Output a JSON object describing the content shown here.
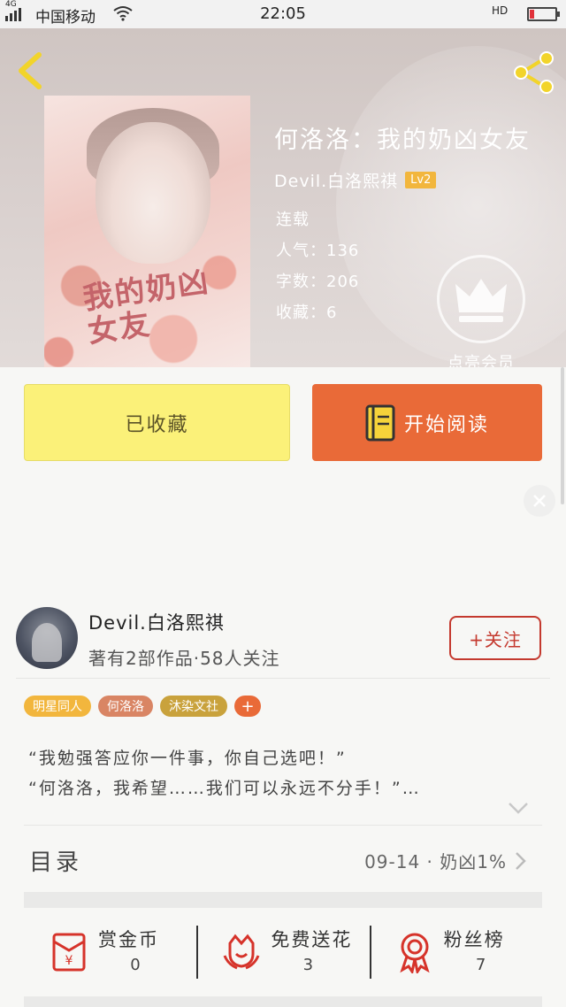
{
  "status_bar": {
    "network": "4G",
    "carrier": "中国移动",
    "time": "22:05",
    "hd": "HD"
  },
  "book": {
    "title": "何洛洛：我的奶凶女友",
    "author": "Devil.白洛熙祺",
    "level": "Lv2",
    "status": "连载",
    "popularity": "人气：136",
    "word_count": "字数：206",
    "favorites": "收藏：6",
    "cover_text": "我的奶凶女友"
  },
  "vip": {
    "label": "点亮会员"
  },
  "actions": {
    "collected_label": "已收藏",
    "read_label": "开始阅读"
  },
  "author_card": {
    "name": "Devil.白洛熙祺",
    "meta": "著有2部作品·58人关注",
    "follow_label": "+关注"
  },
  "tags": [
    {
      "label": "明星同人",
      "color": "#f2b63d"
    },
    {
      "label": "何洛洛",
      "color": "#d98564"
    },
    {
      "label": "沐染文社",
      "color": "#c9a23c"
    },
    {
      "label": "+",
      "color": "#e96a38"
    }
  ],
  "intro": {
    "line1": "“我勉强答应你一件事，你自己选吧！”",
    "line2": "“何洛洛，我希望……我们可以永远不分手！”…"
  },
  "toc": {
    "label": "目录",
    "latest": "09-14 · 奶凶1%"
  },
  "rewards": [
    {
      "label": "赏金币",
      "count": "0",
      "icon": "red-envelope-icon"
    },
    {
      "label": "免费送花",
      "count": "3",
      "icon": "flower-icon"
    },
    {
      "label": "粉丝榜",
      "count": "7",
      "icon": "rosette-icon"
    }
  ],
  "colors": {
    "accent_orange": "#e96a38",
    "collected_yellow": "#fbf179",
    "follow_red": "#c4392e",
    "icon_red": "#d6332a",
    "back_yellow": "#f2d42a"
  }
}
